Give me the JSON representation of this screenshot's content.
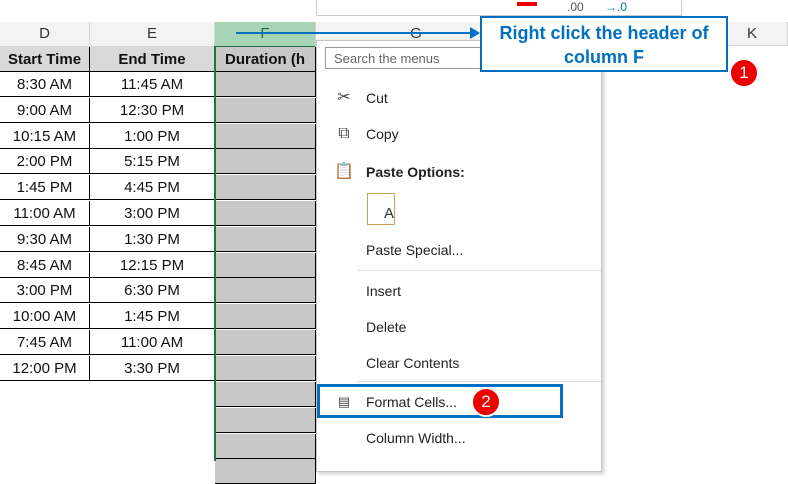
{
  "columns": {
    "d": "D",
    "e": "E",
    "f": "F",
    "g": "G",
    "h": "K"
  },
  "table": {
    "headers": [
      "Start Time",
      "End Time",
      "Duration (h"
    ],
    "rows": [
      [
        "8:30 AM",
        "11:45 AM"
      ],
      [
        "9:00 AM",
        "12:30 PM"
      ],
      [
        "10:15 AM",
        "1:00 PM"
      ],
      [
        "2:00 PM",
        "5:15 PM"
      ],
      [
        "1:45 PM",
        "4:45 PM"
      ],
      [
        "11:00 AM",
        "3:00 PM"
      ],
      [
        "9:30 AM",
        "1:30 PM"
      ],
      [
        "8:45 AM",
        "12:15 PM"
      ],
      [
        "3:00 PM",
        "6:30 PM"
      ],
      [
        "10:00 AM",
        "1:45 PM"
      ],
      [
        "7:45 AM",
        "11:00 AM"
      ],
      [
        "12:00 PM",
        "3:30 PM"
      ]
    ]
  },
  "toolbar": {
    "decimals": ".00",
    "decimals2": "→.0"
  },
  "menu": {
    "search_placeholder": "Search the menus",
    "cut": "Cut",
    "copy": "Copy",
    "paste_options": "Paste Options:",
    "paste_a": "A",
    "paste_special": "Paste Special...",
    "insert": "Insert",
    "delete": "Delete",
    "clear": "Clear Contents",
    "format": "Format Cells...",
    "width": "Column Width..."
  },
  "callout": {
    "text": "Right click the header of column F",
    "step1": "1",
    "step2": "2"
  },
  "colors": {
    "accent": "#0070c0",
    "badge": "#e00000",
    "selected_header": "#a8d5b5"
  }
}
